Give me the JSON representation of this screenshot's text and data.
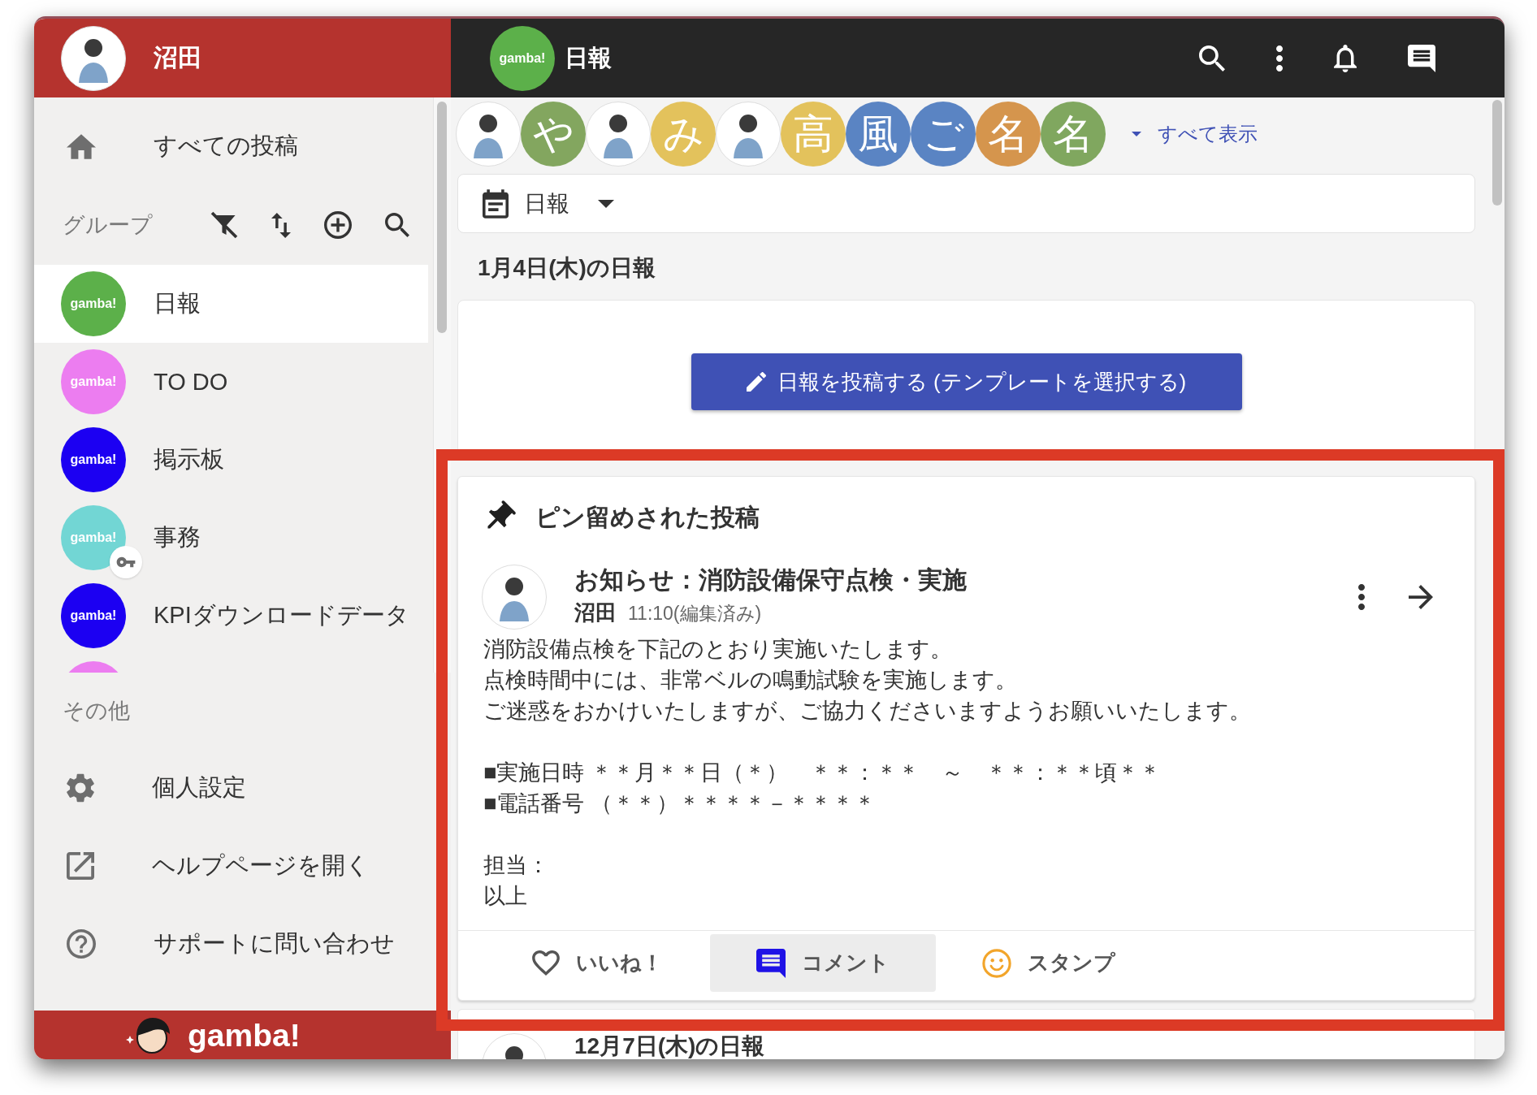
{
  "sidebar": {
    "user": {
      "name": "沼田"
    },
    "nav": [
      {
        "kind": "home",
        "label": "すべての投稿"
      }
    ],
    "groups_header": "グループ",
    "groups": [
      {
        "name": "日報",
        "avatar_text": "gamba!",
        "color": "#5cb04a",
        "selected": true,
        "locked": false
      },
      {
        "name": "TO DO",
        "avatar_text": "gamba!",
        "color": "#ec7df0",
        "selected": false,
        "locked": false
      },
      {
        "name": "掲示板",
        "avatar_text": "gamba!",
        "color": "#1c00f2",
        "selected": false,
        "locked": false
      },
      {
        "name": "事務",
        "avatar_text": "gamba!",
        "color": "#72d6d4",
        "selected": false,
        "locked": true
      },
      {
        "name": "KPIダウンロードデータ",
        "avatar_text": "gamba!",
        "color": "#1c00f2",
        "selected": false,
        "locked": false
      },
      {
        "color": "#ec7df0",
        "selected": false,
        "locked": false
      }
    ],
    "other_header": "その他",
    "other": [
      {
        "kind": "settings",
        "label": "個人設定"
      },
      {
        "kind": "help",
        "label": "ヘルプページを開く"
      },
      {
        "kind": "support",
        "label": "サポートに問い合わせ"
      }
    ],
    "footer": {
      "logo": "gamba!"
    }
  },
  "topbar": {
    "group": {
      "avatar_text": "gamba!",
      "color": "#5cb04a",
      "title": "日報"
    }
  },
  "members": {
    "avatars": [
      {
        "kind": "image"
      },
      {
        "kind": "letter",
        "text": "や",
        "color": "#83a65f"
      },
      {
        "kind": "image"
      },
      {
        "kind": "letter",
        "text": "み",
        "color": "#e3c25c"
      },
      {
        "kind": "image"
      },
      {
        "kind": "letter",
        "text": "高",
        "color": "#e3c25c"
      },
      {
        "kind": "letter",
        "text": "風",
        "color": "#5a84c3"
      },
      {
        "kind": "letter",
        "text": "ご",
        "color": "#5a84c3"
      },
      {
        "kind": "letter",
        "text": "名",
        "color": "#d5954d"
      },
      {
        "kind": "letter",
        "text": "名",
        "color": "#80a75f"
      }
    ],
    "show_all": "すべて表示"
  },
  "filter": {
    "value": "日報"
  },
  "date_heading": "1月4日(木)の日報",
  "compose": {
    "button": "日報を投稿する (テンプレートを選択する)"
  },
  "pinned": {
    "highlighted": true,
    "heading": "ピン留めされた投稿",
    "post": {
      "title": "お知らせ：消防設備保守点検・実施",
      "author": "沼田",
      "time": "11:10(編集済み)",
      "body": [
        [
          "消防設備点検を下記のとおり実施いたします。",
          "点検時間中には、非常ベルの鳴動試験を実施します。",
          "ご迷惑をおかけいたしますが、ご協力くださいますようお願いいたします。"
        ],
        [
          "■実施日時 ＊＊月＊＊日（＊）　＊＊：＊＊　～　＊＊：＊＊頃＊＊",
          "■電話番号 （＊＊）＊＊＊＊－＊＊＊＊"
        ],
        [
          "担当：",
          "以上"
        ]
      ],
      "actions": [
        {
          "kind": "like",
          "label": "いいね！",
          "selected": false
        },
        {
          "kind": "comment",
          "label": "コメント",
          "selected": true
        },
        {
          "kind": "stamp",
          "label": "スタンプ",
          "selected": false
        }
      ]
    }
  },
  "next_post": {
    "title": "12月7日(木)の日報"
  }
}
